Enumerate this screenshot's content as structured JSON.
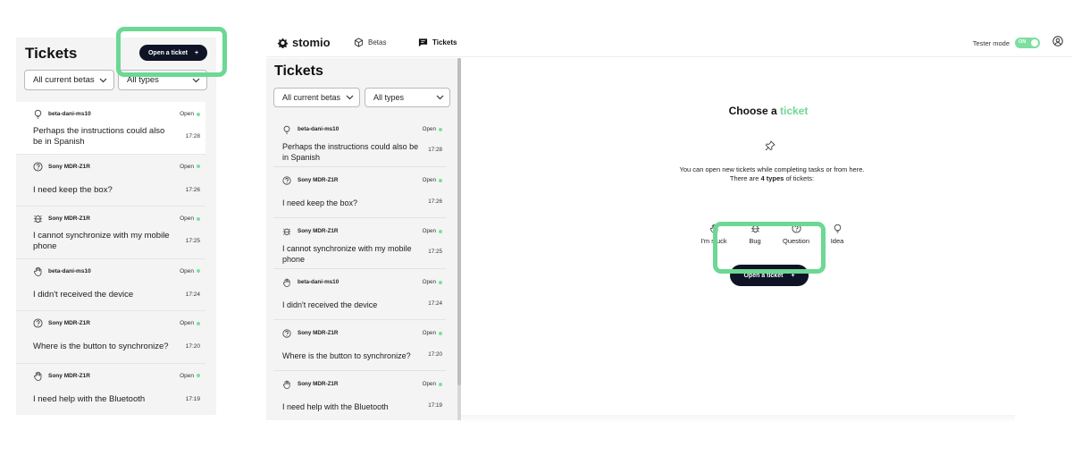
{
  "zoom": {
    "title": "Tickets",
    "open_button": "Open a ticket",
    "filter_betas": "All current betas",
    "filter_types": "All types",
    "tickets": [
      {
        "icon": "lightbulb-icon",
        "source": "beta-dani-ms10",
        "status": "Open",
        "text": "Perhaps the instructions could also be in Spanish",
        "time": "17:28"
      },
      {
        "icon": "question-icon",
        "source": "Sony MDR-Z1R",
        "status": "Open",
        "text": "I need keep the box?",
        "time": "17:26"
      },
      {
        "icon": "bug-icon",
        "source": "Sony MDR-Z1R",
        "status": "Open",
        "text": "I cannot synchronize with my mobile phone",
        "time": "17:25"
      },
      {
        "icon": "hand-icon",
        "source": "beta-dani-ms10",
        "status": "Open",
        "text": "I didn't received the device",
        "time": "17:24"
      },
      {
        "icon": "question-icon",
        "source": "Sony MDR-Z1R",
        "status": "Open",
        "text": "Where is the button to synchronize?",
        "time": "17:20"
      },
      {
        "icon": "hand-icon",
        "source": "Sony MDR-Z1R",
        "status": "Open",
        "text": "I need help with the Bluetooth",
        "time": "17:19"
      }
    ]
  },
  "app": {
    "logo": "stomio",
    "nav": {
      "betas": "Betas",
      "tickets": "Tickets"
    },
    "tester_mode": "Tester mode",
    "toggle_on": "ON",
    "sidebar": {
      "title": "Tickets",
      "filter_betas": "All current betas",
      "filter_types": "All types",
      "tickets": [
        {
          "icon": "lightbulb-icon",
          "source": "beta-dani-ms10",
          "status": "Open",
          "text": "Perhaps the instructions could also be in Spanish",
          "time": "17:28"
        },
        {
          "icon": "question-icon",
          "source": "Sony MDR-Z1R",
          "status": "Open",
          "text": "I need keep the box?",
          "time": "17:26"
        },
        {
          "icon": "bug-icon",
          "source": "Sony MDR-Z1R",
          "status": "Open",
          "text": "I cannot synchronize with my mobile phone",
          "time": "17:25"
        },
        {
          "icon": "hand-icon",
          "source": "beta-dani-ms10",
          "status": "Open",
          "text": "I didn't received the device",
          "time": "17:24"
        },
        {
          "icon": "question-icon",
          "source": "Sony MDR-Z1R",
          "status": "Open",
          "text": "Where is the button to synchronize?",
          "time": "17:20"
        },
        {
          "icon": "hand-icon",
          "source": "Sony MDR-Z1R",
          "status": "Open",
          "text": "I need help with the Bluetooth",
          "time": "17:19"
        }
      ]
    },
    "content": {
      "choose_prefix": "Choose a",
      "choose_accent": "ticket",
      "desc_line1": "You can open new tickets while completing tasks or from here.",
      "desc_line2_prefix": "There are",
      "desc_line2_bold": "4 types",
      "desc_line2_suffix": "of tickets:",
      "types": [
        "I'm stuck",
        "Bug",
        "Question",
        "Idea"
      ],
      "cta": "Open a ticket"
    }
  },
  "colors": {
    "accent": "#6cd893",
    "dark_button": "#0e1426",
    "panel_bg": "#f4f4f4"
  }
}
